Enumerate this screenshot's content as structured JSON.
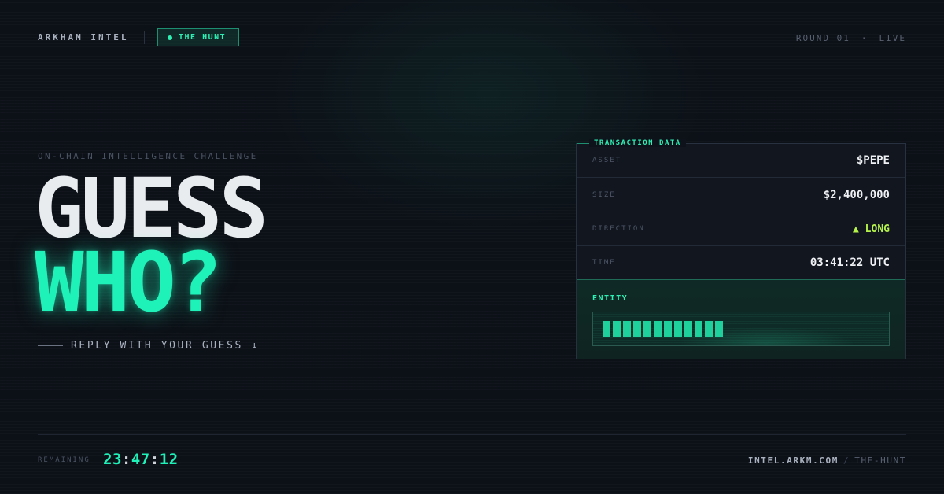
{
  "header": {
    "brand": "ARKHAM INTEL",
    "tag": "THE HUNT",
    "round": "ROUND 01",
    "separator": "·",
    "status": "LIVE"
  },
  "hero": {
    "subtitle": "ON-CHAIN INTELLIGENCE CHALLENGE",
    "line1": "GUESS",
    "line2": "WHO?",
    "cta": "REPLY WITH YOUR GUESS ↓"
  },
  "card": {
    "title": "TRANSACTION DATA",
    "rows": [
      {
        "label": "ASSET",
        "value": "$PEPE"
      },
      {
        "label": "SIZE",
        "value": "$2,400,000"
      },
      {
        "label": "DIRECTION",
        "value": "▲ LONG"
      },
      {
        "label": "TIME",
        "value": "03:41:22 UTC"
      }
    ],
    "entity_label": "ENTITY",
    "entity_redacted_blocks": 12
  },
  "footer": {
    "remaining_label": "REMAINING",
    "timer": {
      "h": "23",
      "m": "47",
      "s": "12"
    },
    "domain": "INTEL.ARKM.COM",
    "slash": "/",
    "path": "THE-HUNT"
  },
  "colors": {
    "background": "#0c1017",
    "accent": "#1ff2b9",
    "long": "#b5f24a",
    "text": "#e9ecef"
  }
}
